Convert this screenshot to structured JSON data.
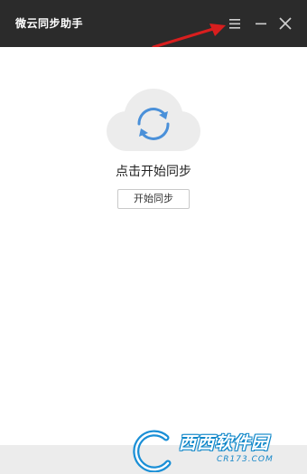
{
  "window": {
    "title": "微云同步助手"
  },
  "main": {
    "prompt_text": "点击开始同步",
    "sync_button_label": "开始同步"
  },
  "watermark": {
    "brand": "西西软件园",
    "domain": "CR173.COM"
  },
  "icons": {
    "menu": "hamburger-menu-icon",
    "minimize": "minimize-icon",
    "close": "close-icon",
    "sync": "sync-refresh-icon",
    "cloud": "cloud-icon"
  },
  "colors": {
    "titlebar_bg": "#2b2b2b",
    "accent_blue": "#4a90d9",
    "cloud_gray": "#ececec",
    "annotation_red": "#d81e1e"
  }
}
